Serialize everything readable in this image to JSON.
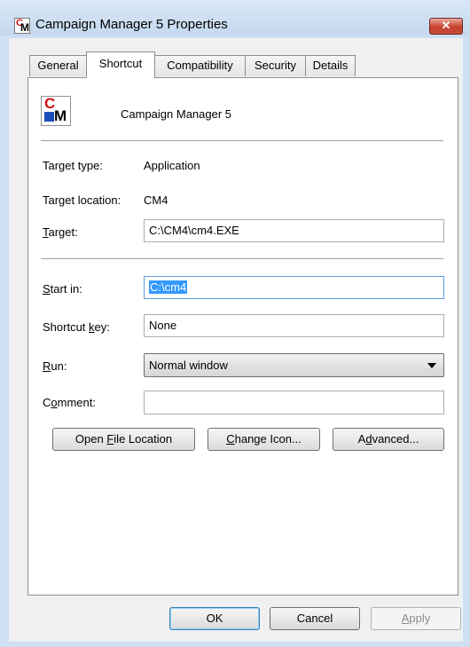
{
  "window": {
    "title": "Campaign Manager 5 Properties",
    "close_label": "✕"
  },
  "tabs": [
    {
      "label": "General"
    },
    {
      "label": "Shortcut"
    },
    {
      "label": "Compatibility"
    },
    {
      "label": "Security"
    },
    {
      "label": "Details"
    }
  ],
  "active_tab": "Shortcut",
  "header": {
    "app_name": "Campaign Manager 5"
  },
  "info": {
    "target_type_label": "Target type:",
    "target_type_value": "Application",
    "target_location_label": "Target location:",
    "target_location_value": "CM4"
  },
  "fields": {
    "target": {
      "label_first": "T",
      "label_rest": "arget:",
      "value": "C:\\CM4\\cm4.EXE"
    },
    "start_in": {
      "label_first": "S",
      "label_rest": "tart in:",
      "value": "C:\\cm4"
    },
    "shortcut_key": {
      "label_pre": "Shortcut ",
      "label_ul": "k",
      "label_post": "ey:",
      "value": "None"
    },
    "run": {
      "label_first": "R",
      "label_rest": "un:",
      "value": "Normal window"
    },
    "comment": {
      "label_pre": "C",
      "label_ul": "o",
      "label_post": "mment:",
      "value": ""
    }
  },
  "action_buttons": {
    "open_file_location": {
      "pre": "Open ",
      "ul": "F",
      "post": "ile Location"
    },
    "change_icon": {
      "pre": "",
      "ul": "C",
      "post": "hange Icon..."
    },
    "advanced": {
      "pre": "A",
      "ul": "d",
      "post": "vanced..."
    }
  },
  "dialog_buttons": {
    "ok": "OK",
    "cancel": "Cancel",
    "apply": {
      "ul": "A",
      "post": "pply"
    }
  }
}
